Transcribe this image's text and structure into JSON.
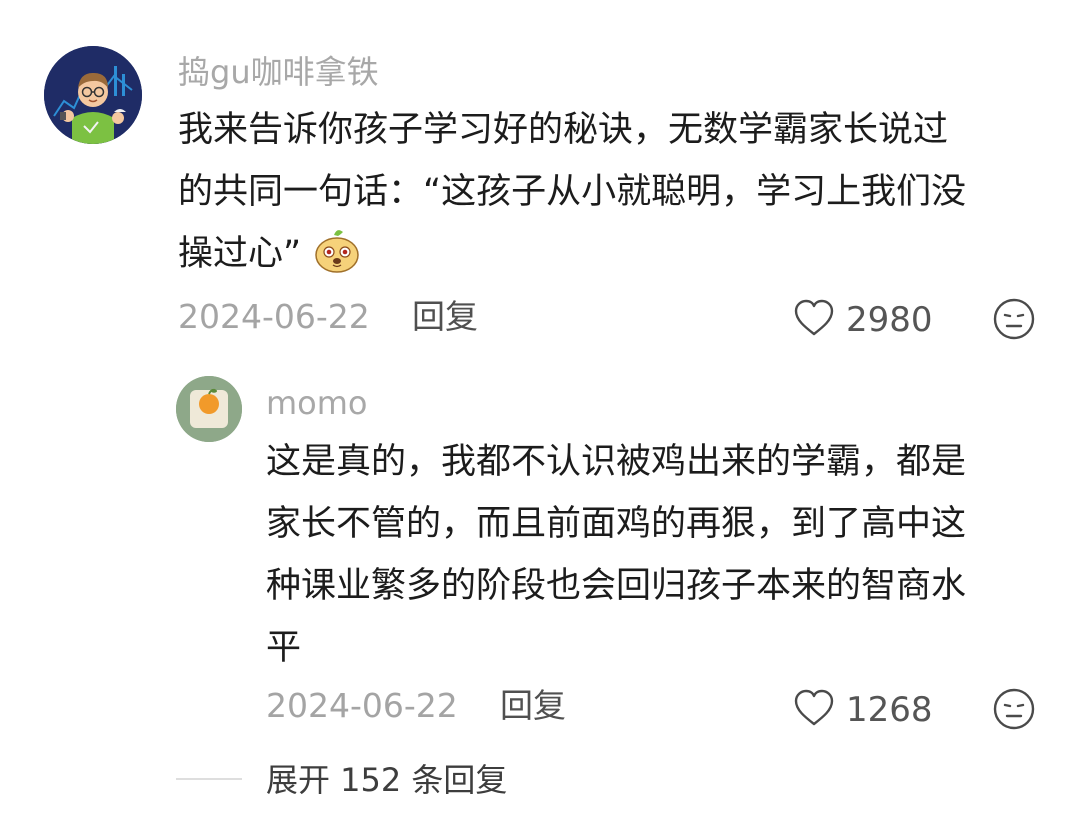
{
  "comment": {
    "username": "捣gu咖啡拿铁",
    "lines": [
      "我来告诉你孩子学习好的秘诀，无数学霸家长说过",
      "的共同一句话：“这孩子从小就聪明，学习上我们没",
      "操过心”"
    ],
    "emoji": "laughing-face-sticker",
    "date": "2024-06-22",
    "reply_label": "回复",
    "likes": "2980"
  },
  "reply": {
    "username": "momo",
    "lines": [
      "这是真的，我都不认识被鸡出来的学霸，都是",
      "家长不管的，而且前面鸡的再狠，到了高中这",
      "种课业繁多的阶段也会回归孩子本来的智商水",
      "平"
    ],
    "date": "2024-06-22",
    "reply_label": "回复",
    "likes": "1268"
  },
  "expand": {
    "label": "展开 152 条回复"
  },
  "colors": {
    "avatar_main_bg": "#1f2c66",
    "avatar_sub_bg": "#8ea889",
    "meta_gray": "#a4a4a4",
    "username_gray": "#a8a8a8",
    "body_text": "#1c1c1c"
  },
  "icons": {
    "like": "heart-outline-icon",
    "react": "neutral-face-icon",
    "emoji": "laughing-face-sticker"
  }
}
